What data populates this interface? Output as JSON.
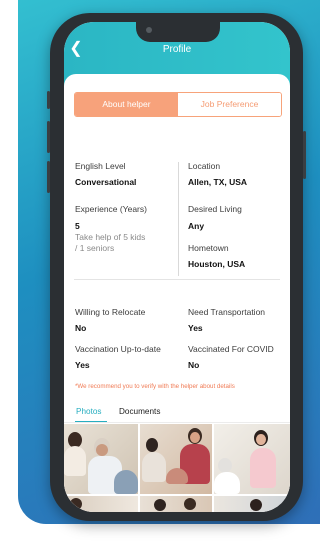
{
  "header": {
    "title": "Profile",
    "back_icon": "chevron-left-icon"
  },
  "tabs": {
    "about_label": "About helper",
    "job_label": "Job Preference",
    "active": "about"
  },
  "details": {
    "english_level_label": "English Level",
    "english_level_value": "Conversational",
    "experience_label": "Experience (Years)",
    "experience_value": "5",
    "experience_note_line1": "Take help of 5 kids",
    "experience_note_line2": "/ 1 seniors",
    "location_label": "Location",
    "location_value": "Allen, TX, USA",
    "desired_living_label": "Desired Living",
    "desired_living_value": "Any",
    "hometown_label": "Hometown",
    "hometown_value": "Houston, USA",
    "relocate_label": "Willing to Relocate",
    "relocate_value": "No",
    "transport_label": "Need Transportation",
    "transport_value": "Yes",
    "vaccination_label": "Vaccination Up-to-date",
    "vaccination_value": "Yes",
    "covid_label": "Vaccinated For COVID",
    "covid_value": "No"
  },
  "warning_text": "*We recommend you to verify with the helper about details",
  "media_tabs": {
    "photos_label": "Photos",
    "documents_label": "Documents",
    "active": "photos"
  },
  "colors": {
    "accent_teal": "#27aec0",
    "accent_orange": "#f7a27b",
    "warning_orange": "#f07b55",
    "background_blue": "#1e8fc0"
  }
}
